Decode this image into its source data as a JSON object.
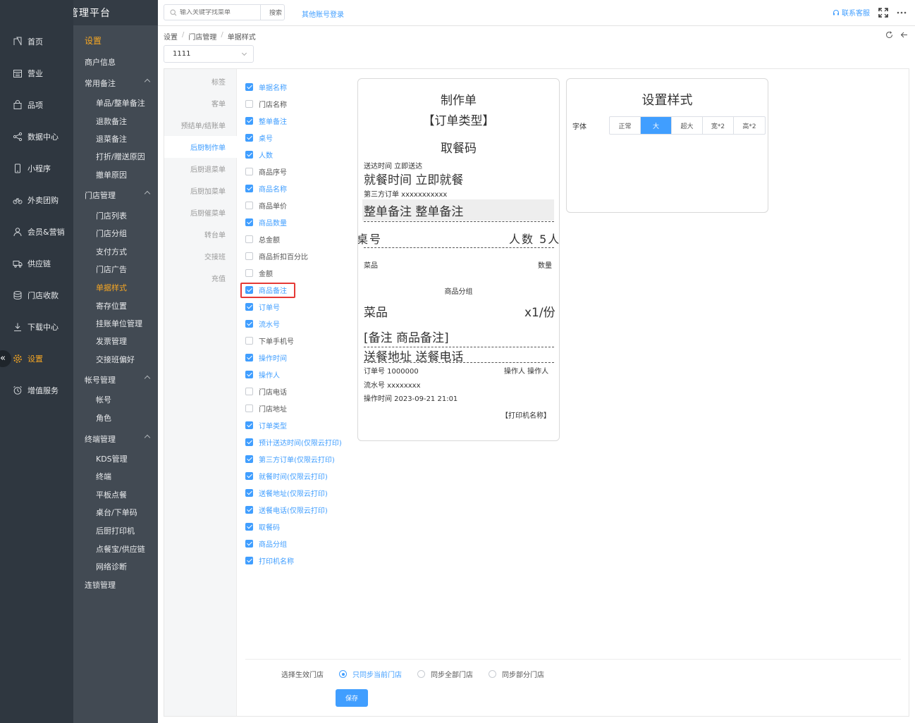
{
  "brand": "商户管理平台",
  "nav_primary": [
    {
      "label": "首页",
      "icon": "home-icon"
    },
    {
      "label": "营业",
      "icon": "calendar-icon"
    },
    {
      "label": "品项",
      "icon": "bag-icon"
    },
    {
      "label": "数据中心",
      "icon": "share-icon"
    },
    {
      "label": "小程序",
      "icon": "phone-icon"
    },
    {
      "label": "外卖团购",
      "icon": "bike-icon"
    },
    {
      "label": "会员&营销",
      "icon": "user-icon"
    },
    {
      "label": "供应链",
      "icon": "truck-icon"
    },
    {
      "label": "门店收款",
      "icon": "coins-icon"
    },
    {
      "label": "下载中心",
      "icon": "download-icon"
    },
    {
      "label": "设置",
      "icon": "gear-icon",
      "active": true
    },
    {
      "label": "增值服务",
      "icon": "alarm-icon"
    }
  ],
  "nav_secondary": {
    "title": "设置",
    "items": [
      {
        "label": "商户信息",
        "level": "sec"
      },
      {
        "label": "常用备注",
        "level": "sec",
        "expand": true
      },
      {
        "label": "单品/整单备注",
        "level": "sub"
      },
      {
        "label": "退款备注",
        "level": "sub"
      },
      {
        "label": "退菜备注",
        "level": "sub"
      },
      {
        "label": "打折/赠送原因",
        "level": "sub"
      },
      {
        "label": "撤单原因",
        "level": "sub"
      },
      {
        "label": "门店管理",
        "level": "sec",
        "expand": true
      },
      {
        "label": "门店列表",
        "level": "sub"
      },
      {
        "label": "门店分组",
        "level": "sub"
      },
      {
        "label": "支付方式",
        "level": "sub"
      },
      {
        "label": "门店广告",
        "level": "sub"
      },
      {
        "label": "单据样式",
        "level": "sub",
        "active": true
      },
      {
        "label": "寄存位置",
        "level": "sub"
      },
      {
        "label": "挂账单位管理",
        "level": "sub"
      },
      {
        "label": "发票管理",
        "level": "sub"
      },
      {
        "label": "交接班偏好",
        "level": "sub"
      },
      {
        "label": "帐号管理",
        "level": "sec",
        "expand": true
      },
      {
        "label": "帐号",
        "level": "sub"
      },
      {
        "label": "角色",
        "level": "sub"
      },
      {
        "label": "终端管理",
        "level": "sec",
        "expand": true
      },
      {
        "label": "KDS管理",
        "level": "sub"
      },
      {
        "label": "终端",
        "level": "sub"
      },
      {
        "label": "平板点餐",
        "level": "sub"
      },
      {
        "label": "桌台/下单码",
        "level": "sub"
      },
      {
        "label": "后厨打印机",
        "level": "sub"
      },
      {
        "label": "点餐宝/供应链",
        "level": "sub"
      },
      {
        "label": "网络诊断",
        "level": "sub"
      },
      {
        "label": "连锁管理",
        "level": "sec"
      }
    ]
  },
  "header": {
    "search_placeholder": "输入关键字找菜单",
    "search_button": "搜索",
    "other_login": "其他账号登录",
    "contact": "联系客服"
  },
  "breadcrumb": [
    "设置",
    "门店管理",
    "单据样式"
  ],
  "store_select": "1111",
  "tabs": [
    "标签",
    "客单",
    "预结单/结账单",
    "后厨制作单",
    "后厨退菜单",
    "后厨加菜单",
    "后厨催菜单",
    "转台单",
    "交接班",
    "充值"
  ],
  "active_tab": 3,
  "fields": [
    {
      "label": "单据名称",
      "checked": true
    },
    {
      "label": "门店名称",
      "checked": false
    },
    {
      "label": "整单备注",
      "checked": true
    },
    {
      "label": "桌号",
      "checked": true
    },
    {
      "label": "人数",
      "checked": true
    },
    {
      "label": "商品序号",
      "checked": false
    },
    {
      "label": "商品名称",
      "checked": true
    },
    {
      "label": "商品单价",
      "checked": false
    },
    {
      "label": "商品数量",
      "checked": true
    },
    {
      "label": "总金额",
      "checked": false
    },
    {
      "label": "商品折扣百分比",
      "checked": false
    },
    {
      "label": "金额",
      "checked": false
    },
    {
      "label": "商品备注",
      "checked": true
    },
    {
      "label": "订单号",
      "checked": true
    },
    {
      "label": "流水号",
      "checked": true
    },
    {
      "label": "下单手机号",
      "checked": false
    },
    {
      "label": "操作时间",
      "checked": true
    },
    {
      "label": "操作人",
      "checked": true
    },
    {
      "label": "门店电话",
      "checked": false
    },
    {
      "label": "门店地址",
      "checked": false
    },
    {
      "label": "订单类型",
      "checked": true
    },
    {
      "label": "预计送达时间(仅限云打印)",
      "checked": true
    },
    {
      "label": "第三方订单(仅限云打印)",
      "checked": true
    },
    {
      "label": "就餐时间(仅限云打印)",
      "checked": true
    },
    {
      "label": "送餐地址(仅限云打印)",
      "checked": true
    },
    {
      "label": "送餐电话(仅限云打印)",
      "checked": true
    },
    {
      "label": "取餐码",
      "checked": true
    },
    {
      "label": "商品分组",
      "checked": true
    },
    {
      "label": "打印机名称",
      "checked": true
    }
  ],
  "receipt": {
    "title": "制作单",
    "order_type": "【订单类型】",
    "pickup_code": "取餐码",
    "delivery_time": "送达时间 立即送达",
    "dine_time": "就餐时间 立即就餐",
    "third_party": "第三方订单 xxxxxxxxxxx",
    "order_remark": "整单备注 整单备注",
    "table_no": "桌号",
    "guests": "人数 5人",
    "col_dish": "菜品",
    "col_qty": "数量",
    "group": "商品分组",
    "dish": "菜品",
    "dish_qty": "x1/份",
    "item_remark": "[备注 商品备注]",
    "address_phone": "送餐地址 送餐电话",
    "order_no": "订单号 1000000",
    "operator": "操作人 操作人",
    "serial_no": "流水号 xxxxxxxx",
    "op_time": "操作时间 2023-09-21 21:01",
    "printer": "【打印机名称】"
  },
  "style_settings": {
    "title": "设置样式",
    "font_label": "字体",
    "options": [
      "正常",
      "大",
      "超大",
      "宽*2",
      "高*2"
    ],
    "selected": "大"
  },
  "footer": {
    "store_label": "选择生效门店",
    "options": [
      "只同步当前门店",
      "同步全部门店",
      "同步部分门店"
    ],
    "selected": 0,
    "save": "保存"
  },
  "colors": {
    "accent": "#409eff",
    "active_nav": "#f5a623",
    "sidebar_dark": "#2f3740",
    "sidebar_light": "#424a53"
  }
}
